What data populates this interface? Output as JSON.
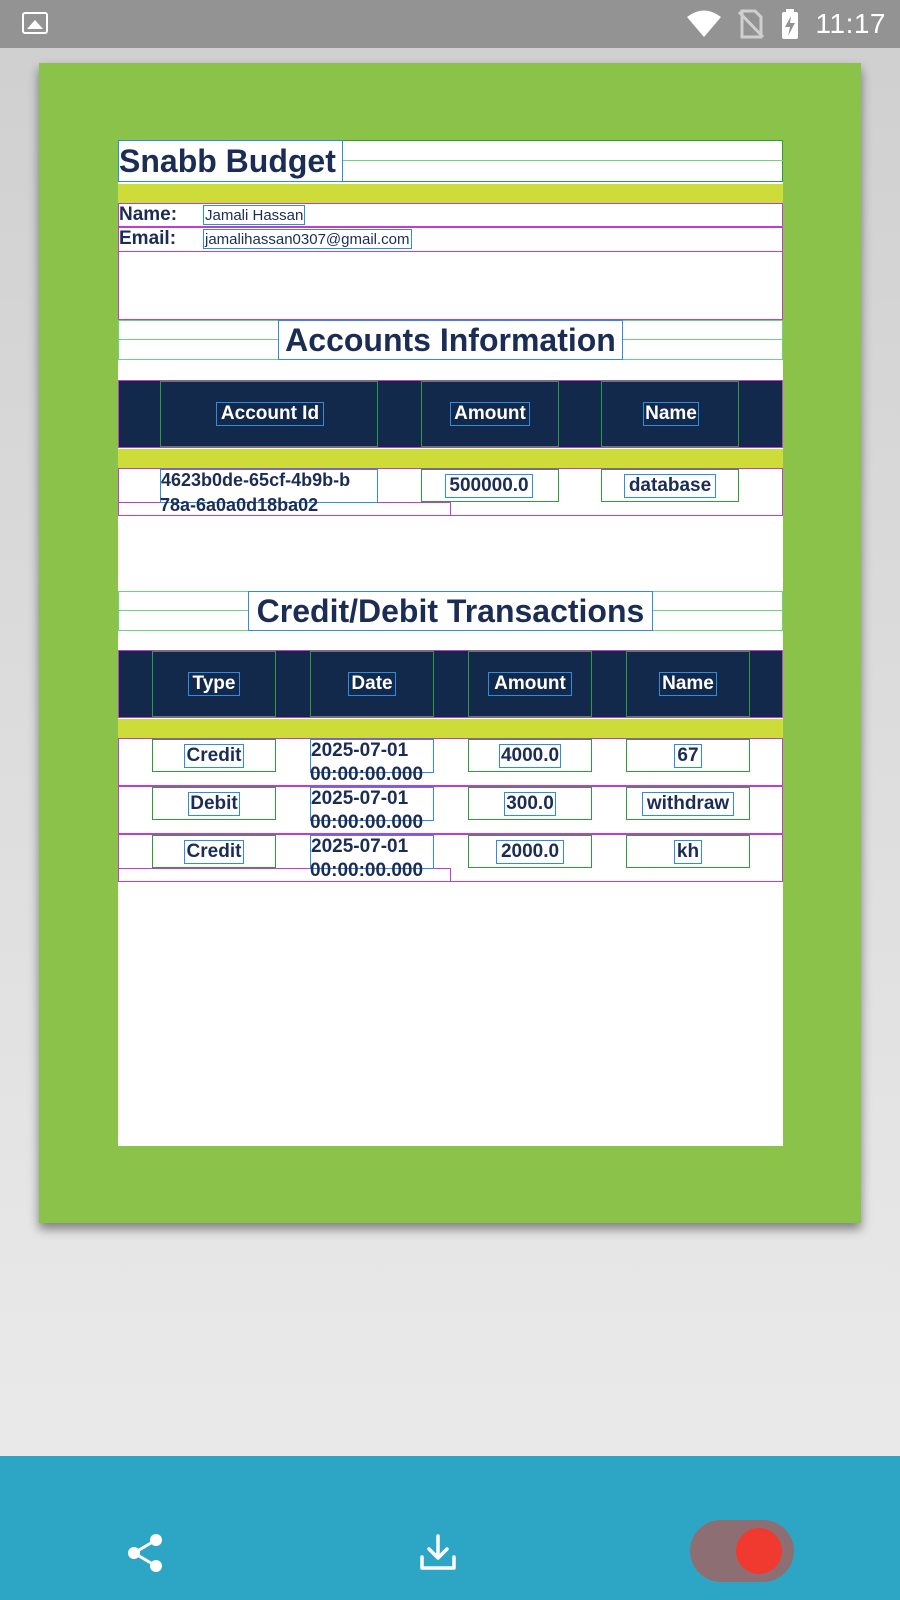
{
  "status_bar": {
    "time": "11:17",
    "icons": [
      "image-notification-icon",
      "wifi-icon",
      "no-sim-icon",
      "battery-charging-icon"
    ]
  },
  "document": {
    "title": "Snabb Budget",
    "profile": {
      "name_label": "Name:",
      "name_value": "Jamali Hassan",
      "email_label": "Email:",
      "email_value": "jamalihassan0307@gmail.com"
    },
    "accounts": {
      "heading": "Accounts Information",
      "columns": [
        "Account Id",
        "Amount",
        "Name"
      ],
      "rows": [
        {
          "id_line1": "4623b0de-65cf-4b9b-b",
          "id_line2": "78a-6a0a0d18ba02",
          "amount": "500000.0",
          "name": "database"
        }
      ]
    },
    "transactions": {
      "heading": "Credit/Debit Transactions",
      "columns": [
        "Type",
        "Date",
        "Amount",
        "Name"
      ],
      "rows": [
        {
          "type": "Credit",
          "date_line1": "2025-07-01",
          "date_line2": "00:00:00.000",
          "amount": "4000.0",
          "name": "67"
        },
        {
          "type": "Debit",
          "date_line1": "2025-07-01",
          "date_line2": "00:00:00.000",
          "amount": "300.0",
          "name": "withdraw"
        },
        {
          "type": "Credit",
          "date_line1": "2025-07-01",
          "date_line2": "00:00:00.000",
          "amount": "2000.0",
          "name": "kh"
        }
      ]
    }
  },
  "bottom_bar": {
    "share_icon": "share-icon",
    "download_icon": "download-icon",
    "toggle_state": "on"
  },
  "colors": {
    "status_bar": "#939393",
    "card_background": "#8bc34a",
    "navy": "#13294b",
    "yellow_divider": "#cddc39",
    "bottom_bar": "#2ca6c4",
    "toggle_knob": "#f0392f"
  }
}
